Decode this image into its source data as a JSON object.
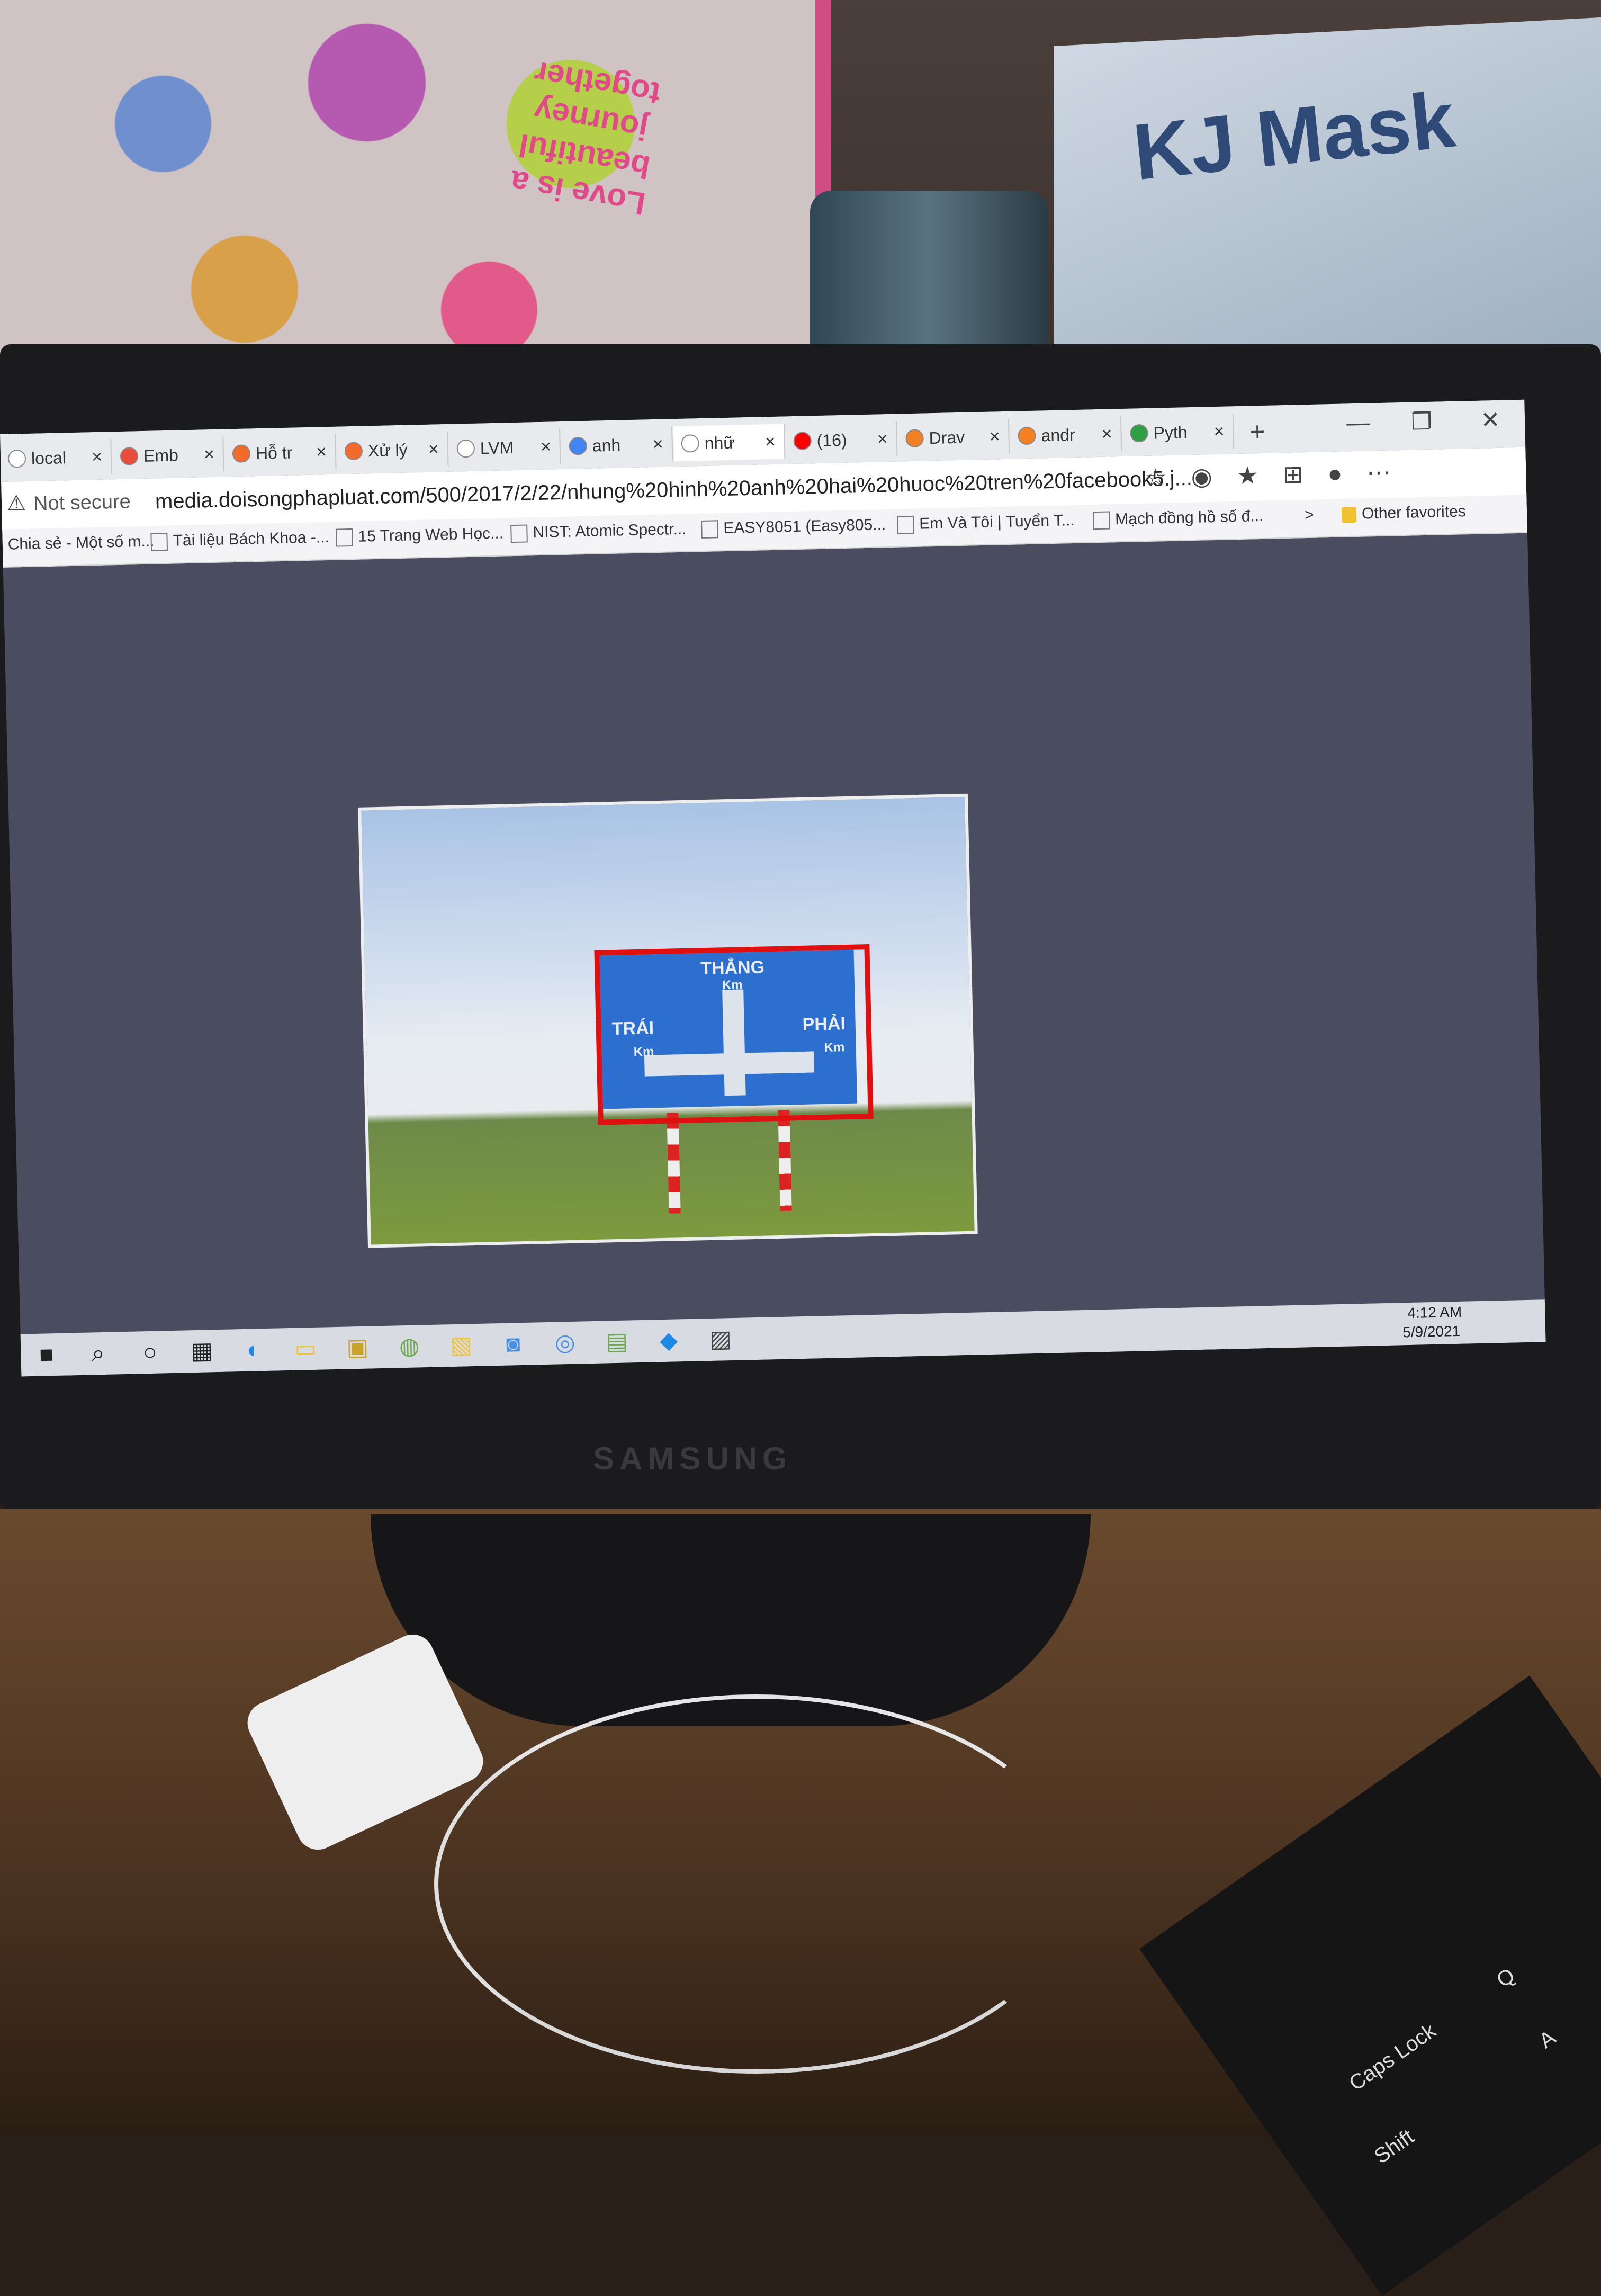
{
  "background": {
    "bag_text": "Love is a beautiful journey together",
    "bag_love": "LOVE",
    "mask_box_title": "KJ Mask"
  },
  "monitor": {
    "brand": "SAMSUNG"
  },
  "browser": {
    "tabs": [
      {
        "label": "local",
        "icon_color": "#ffffff"
      },
      {
        "label": "Emb",
        "icon_color": "#e84d3c"
      },
      {
        "label": "Hỗ tr",
        "icon_color": "#f36b2b"
      },
      {
        "label": "Xử lý",
        "icon_color": "#f36b2b"
      },
      {
        "label": "LVM",
        "icon_color": "#ffffff"
      },
      {
        "label": "anh",
        "icon_color": "#4285f4"
      },
      {
        "label": "nhữ",
        "icon_color": "#ffffff"
      },
      {
        "label": "(16)",
        "icon_color": "#ff0000"
      },
      {
        "label": "Drav",
        "icon_color": "#f48024"
      },
      {
        "label": "andr",
        "icon_color": "#f48024"
      },
      {
        "label": "Pyth",
        "icon_color": "#2f9e44"
      }
    ],
    "new_tab": "+",
    "window_controls": [
      "—",
      "❐",
      "✕"
    ],
    "address": {
      "security": "Not secure",
      "url": "media.doisongphapluat.com/500/2017/2/22/nhung%20hinh%20anh%20hai%20huoc%20tren%20facebook5.j..."
    },
    "favorites": [
      "Chia sẻ - Một số m...",
      "Tài liệu Bách Khoa -...",
      "15 Trang Web Học...",
      "NIST: Atomic Spectr...",
      "EASY8051 (Easy805...",
      "Em Và Tôi | Tuyển T...",
      "Mạch đồng hồ số đ..."
    ],
    "favorites_more": ">",
    "other_favorites": "Other favorites"
  },
  "sign": {
    "straight": "THẲNG",
    "left": "TRÁI",
    "right": "PHẢI",
    "unit": "Km"
  },
  "taskbar": {
    "icons": [
      "windows-icon",
      "search-icon",
      "cortana-icon",
      "task-view-icon",
      "edge-icon",
      "file-explorer-icon",
      "store-icon",
      "paint-icon",
      "sticky-notes-icon",
      "zalo-icon",
      "chat-icon",
      "notepad-icon",
      "vscode-icon",
      "photos-icon"
    ],
    "time": "4:12 AM",
    "date": "5/9/2021"
  },
  "keyboard": {
    "caps": "Caps Lock",
    "shift": "Shift",
    "q": "Q",
    "a": "A"
  }
}
